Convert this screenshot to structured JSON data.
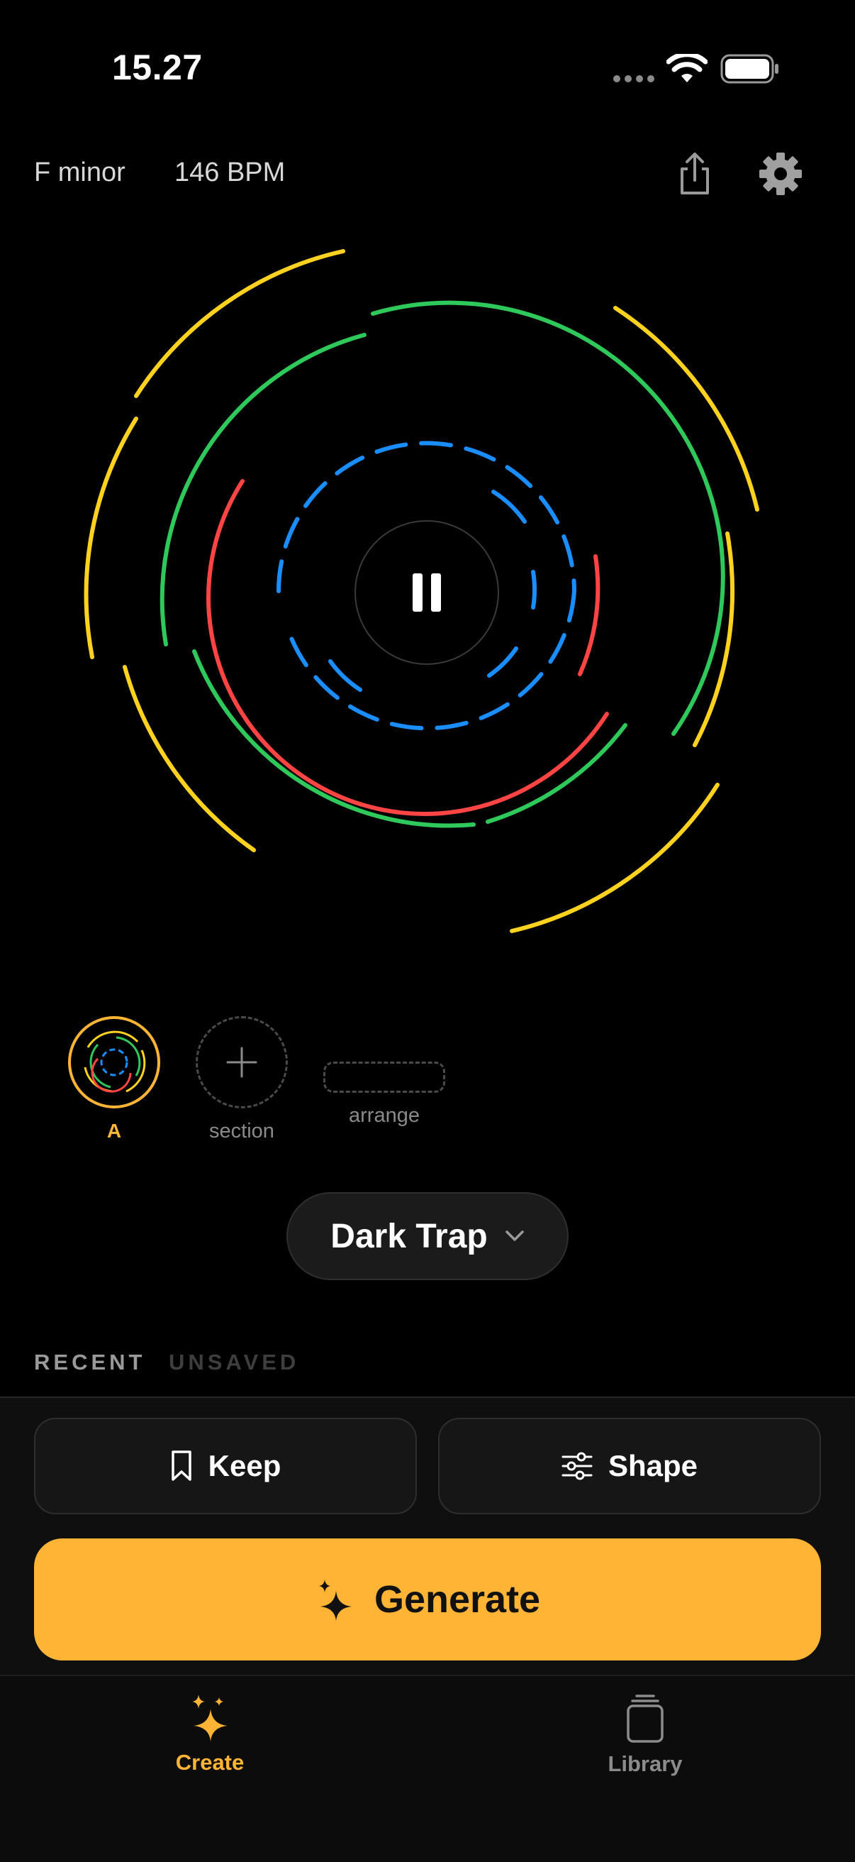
{
  "status_bar": {
    "time": "15.27"
  },
  "header": {
    "key": "F minor",
    "bpm": "146 BPM",
    "share_icon": "share-icon",
    "settings_icon": "gear-icon"
  },
  "player": {
    "state_icon": "pause-icon",
    "ring_colors": [
      "#ffd21f",
      "#2ec95a",
      "#ff4444",
      "#1a8dff"
    ]
  },
  "sections": {
    "items": [
      {
        "label": "A",
        "selected": true
      }
    ],
    "add_label": "section",
    "arrange_label": "arrange"
  },
  "style_picker": {
    "value": "Dark Trap"
  },
  "recent_tabs": {
    "recent": "RECENT",
    "unsaved": "UNSAVED"
  },
  "actions": {
    "keep": "Keep",
    "shape": "Shape",
    "generate": "Generate"
  },
  "tab_bar": {
    "create": "Create",
    "library": "Library",
    "active": "Create"
  },
  "colors": {
    "accent": "#ffb436",
    "background": "#000000"
  }
}
